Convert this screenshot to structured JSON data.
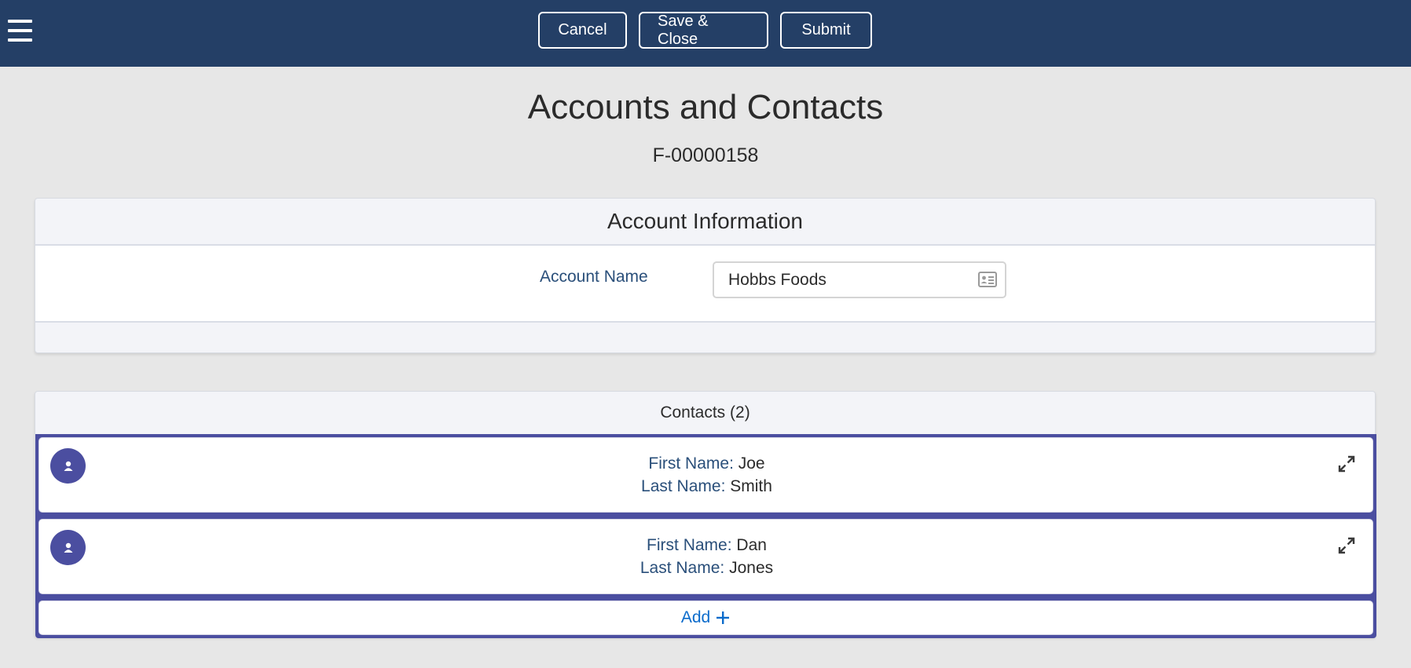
{
  "header": {
    "menu_icon": "hamburger-menu-icon",
    "cancel_label": "Cancel",
    "save_close_label": "Save & Close",
    "submit_label": "Submit",
    "background_color": "#243f66"
  },
  "page": {
    "title": "Accounts and Contacts",
    "record_id": "F-00000158"
  },
  "account_section": {
    "heading": "Account Information",
    "account_name_label": "Account Name",
    "account_name_value": "Hobbs Foods",
    "lookup_icon": "contact-card-icon"
  },
  "contacts_section": {
    "heading": "Contacts (2)",
    "accent_color": "#4b4ea0",
    "first_name_label": "First Name:",
    "last_name_label": "Last Name:",
    "contacts": [
      {
        "first_name": "Joe",
        "last_name": "Smith"
      },
      {
        "first_name": "Dan",
        "last_name": "Jones"
      }
    ],
    "add_label": "Add",
    "add_color": "#0b6bcb"
  }
}
